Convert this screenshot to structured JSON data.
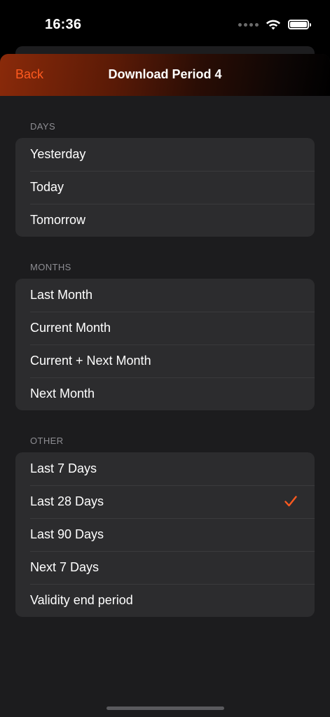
{
  "status_bar": {
    "time": "16:36"
  },
  "nav": {
    "back_label": "Back",
    "title": "Download Period 4"
  },
  "sections": [
    {
      "header": "DAYS",
      "items": [
        "Yesterday",
        "Today",
        "Tomorrow"
      ]
    },
    {
      "header": "MONTHS",
      "items": [
        "Last Month",
        "Current Month",
        "Current + Next Month",
        "Next Month"
      ]
    },
    {
      "header": "OTHER",
      "items": [
        "Last 7 Days",
        "Last 28 Days",
        "Last 90 Days",
        "Next 7 Days",
        "Validity end period"
      ]
    }
  ],
  "selected": "Last 28 Days",
  "colors": {
    "accent": "#FF5A1F",
    "background": "#1C1C1E",
    "cell": "#2C2C2E",
    "separator": "#3A3A3C",
    "section_text": "#8E8E93"
  },
  "icons": {
    "checkmark": "checkmark-icon",
    "wifi": "wifi-icon",
    "battery": "battery-icon",
    "signal": "signal-dots-icon"
  }
}
